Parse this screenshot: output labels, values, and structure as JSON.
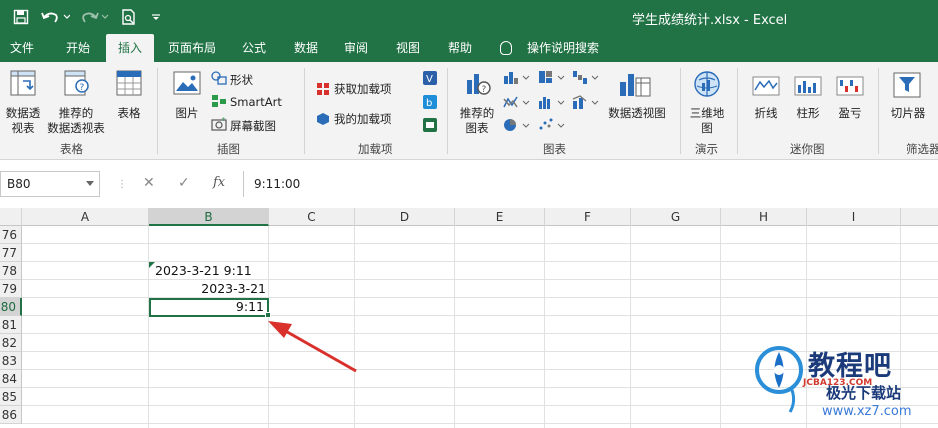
{
  "window": {
    "title": "学生成绩统计.xlsx  -  Excel"
  },
  "quick_access": {
    "save_icon": "save-icon",
    "undo_icon": "undo-icon",
    "redo_icon": "redo-icon",
    "print_preview_icon": "print-preview-icon",
    "customize_icon": "customize-icon"
  },
  "tabs": [
    {
      "label": "文件"
    },
    {
      "label": "开始"
    },
    {
      "label": "插入"
    },
    {
      "label": "页面布局"
    },
    {
      "label": "公式"
    },
    {
      "label": "数据"
    },
    {
      "label": "审阅"
    },
    {
      "label": "视图"
    },
    {
      "label": "帮助"
    },
    {
      "label": "操作说明搜索"
    }
  ],
  "ribbon": {
    "pivot_table": "数据透\n视表",
    "recommended_pivot": "推荐的\n数据透视表",
    "table": "表格",
    "group_tables": "表格",
    "pictures": "图片",
    "shapes": "形状",
    "smartart": "SmartArt",
    "screenshot": "屏幕截图",
    "group_illustrations": "插图",
    "get_addins": "获取加载项",
    "my_addins": "我的加载项",
    "group_addins": "加载项",
    "recommended_charts": "推荐的\n图表",
    "pivot_chart": "数据透视图",
    "group_charts": "图表",
    "map_3d": "三维地\n图",
    "group_tours": "演示",
    "sparkline_line": "折线",
    "sparkline_column": "柱形",
    "sparkline_winloss": "盈亏",
    "group_sparklines": "迷你图",
    "slicer": "切片器",
    "group_filters": "筛选器"
  },
  "formula_bar": {
    "name_box": "B80",
    "cancel_symbol": "✕",
    "enter_symbol": "✓",
    "fx_symbol": "fx",
    "content": "9:11:00"
  },
  "sheet": {
    "columns": [
      "A",
      "B",
      "C",
      "D",
      "E",
      "F",
      "G",
      "H",
      "I"
    ],
    "selected_column": "B",
    "rows": [
      "76",
      "77",
      "78",
      "79",
      "80",
      "81",
      "82",
      "83",
      "84",
      "85",
      "86"
    ],
    "selected_row": "80",
    "cells": {
      "B78": "2023-3-21  9:11",
      "B79": "2023-3-21",
      "B80": "9:11"
    }
  },
  "watermark": {
    "name": "教程吧",
    "site": "JCBA123.COM",
    "download": "极光下载站",
    "url": "www.xz7.com"
  },
  "colors": {
    "excel_green": "#217346",
    "arrow_red": "#d9302b"
  }
}
